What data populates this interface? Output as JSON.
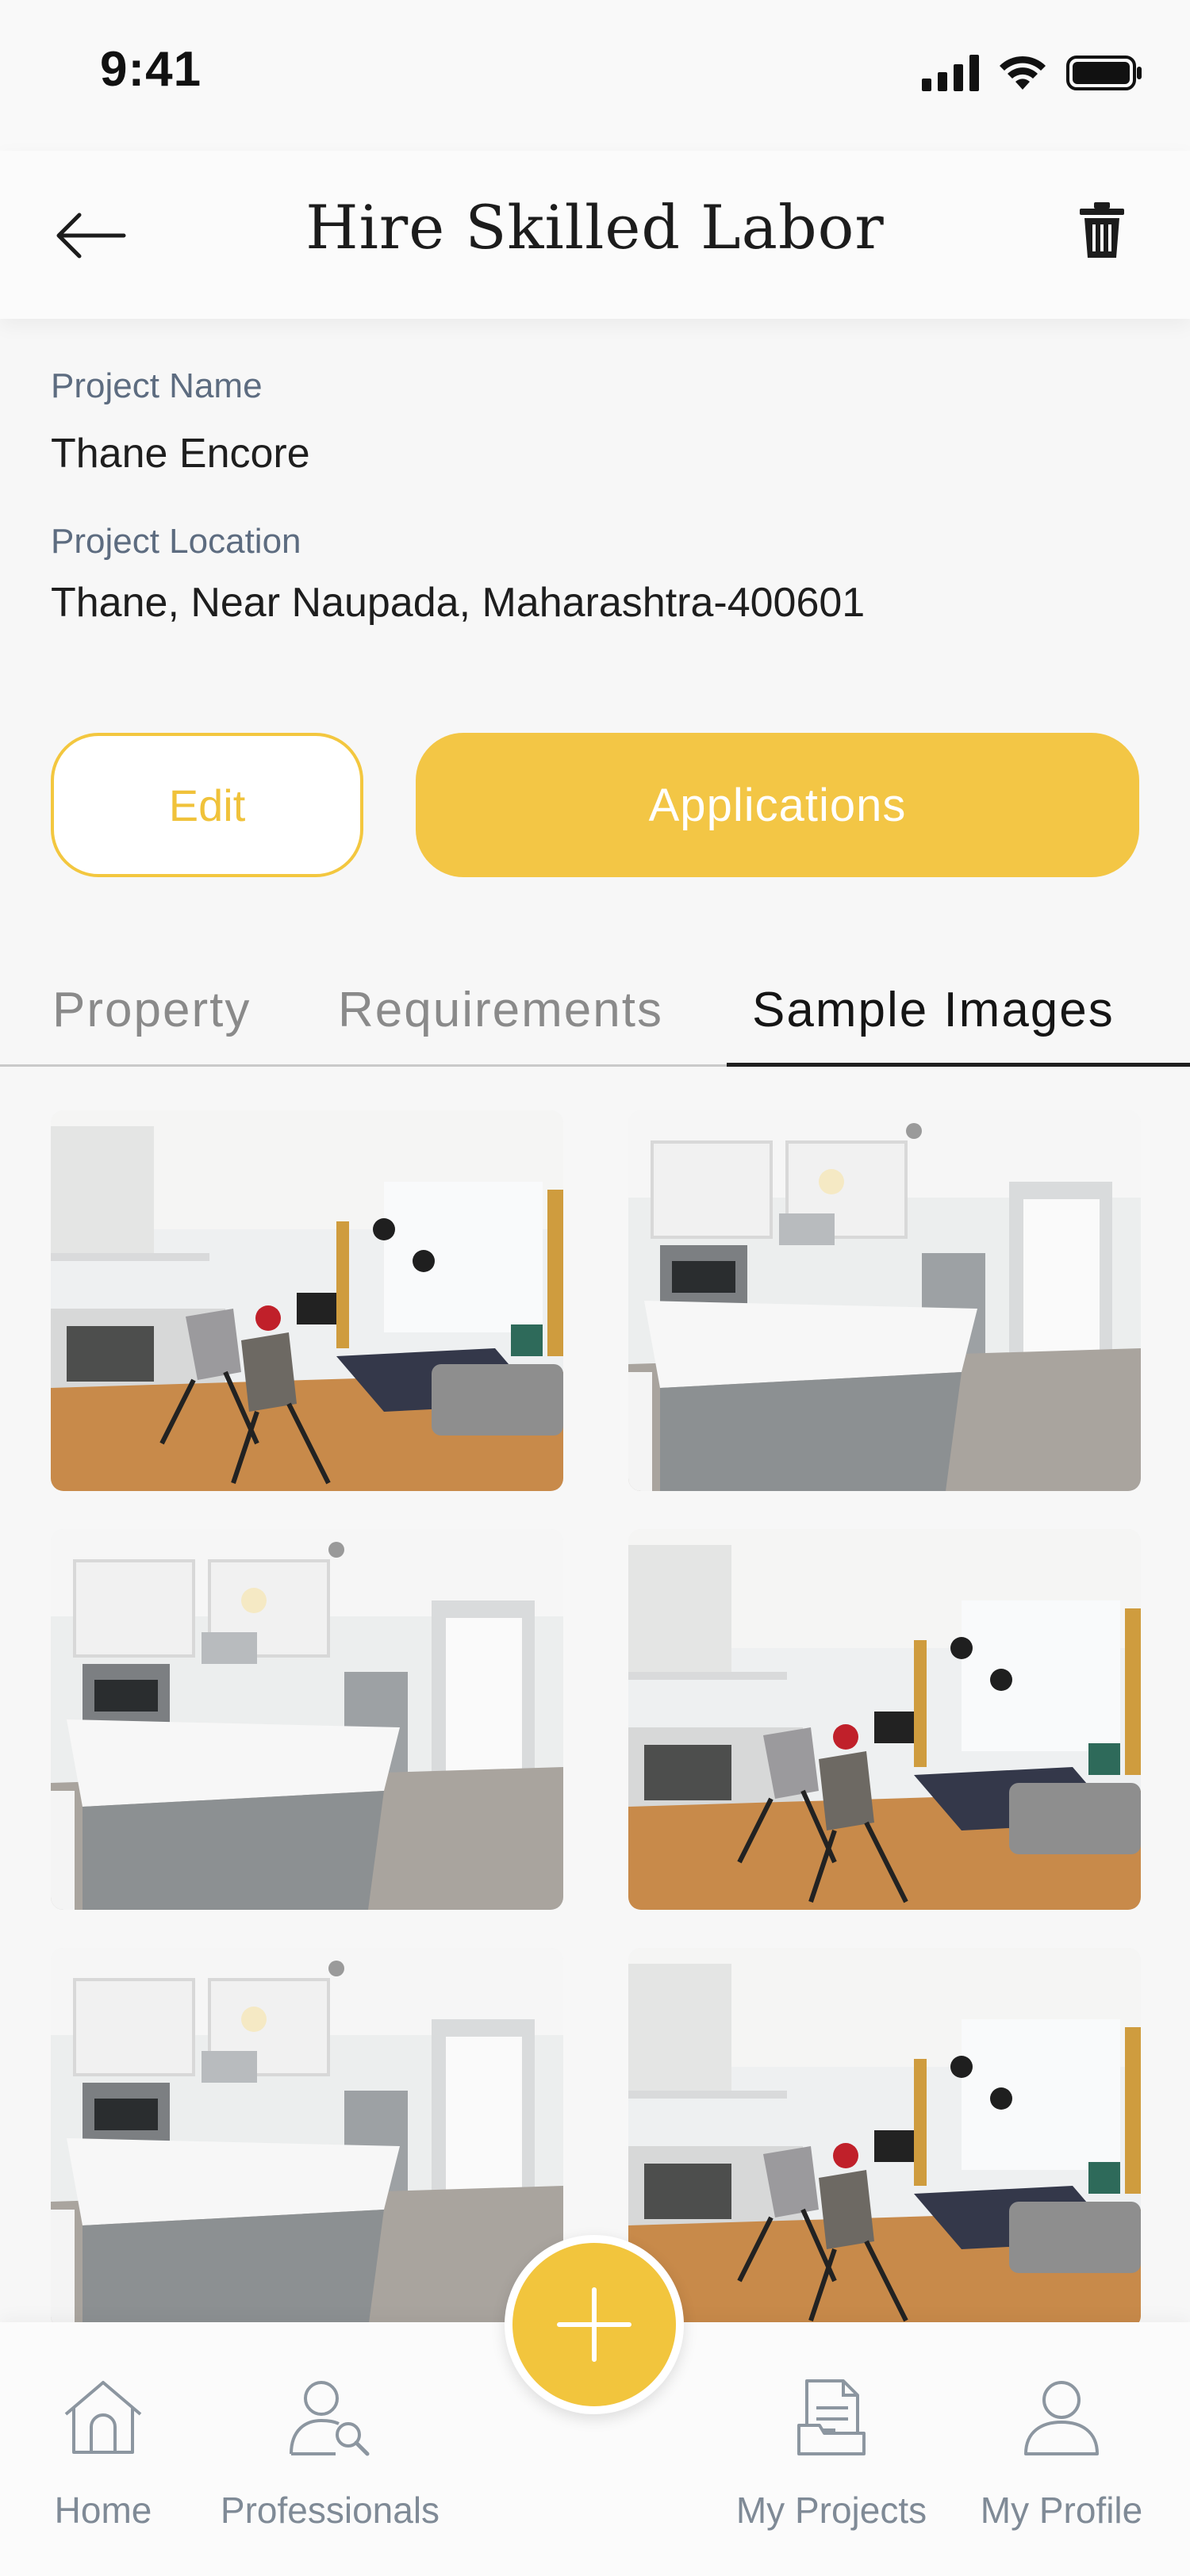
{
  "status_bar": {
    "time": "9:41"
  },
  "header": {
    "title": "Hire Skilled Labor"
  },
  "project": {
    "name_label": "Project Name",
    "name_value": "Thane Encore",
    "location_label": "Project Location",
    "location_value": "Thane, Near Naupada, Maharashtra-400601"
  },
  "actions": {
    "edit_label": "Edit",
    "applications_label": "Applications"
  },
  "tabs": [
    {
      "label": "Property",
      "active": false
    },
    {
      "label": "Requirements",
      "active": false
    },
    {
      "label": "Sample Images",
      "active": true
    }
  ],
  "images": [
    {
      "scene": "living-kitchen"
    },
    {
      "scene": "kitchen-island"
    },
    {
      "scene": "kitchen-island"
    },
    {
      "scene": "living-kitchen"
    },
    {
      "scene": "kitchen-island"
    },
    {
      "scene": "living-kitchen"
    }
  ],
  "bottom_nav": {
    "items": [
      {
        "label": "Home",
        "icon": "home-icon"
      },
      {
        "label": "Professionals",
        "icon": "professionals-icon"
      },
      {
        "label": "My Projects",
        "icon": "projects-icon"
      },
      {
        "label": "My Profile",
        "icon": "profile-icon"
      }
    ]
  },
  "colors": {
    "accent": "#F3C645",
    "label": "#5D6C80",
    "nav_text": "#7F8A96"
  }
}
